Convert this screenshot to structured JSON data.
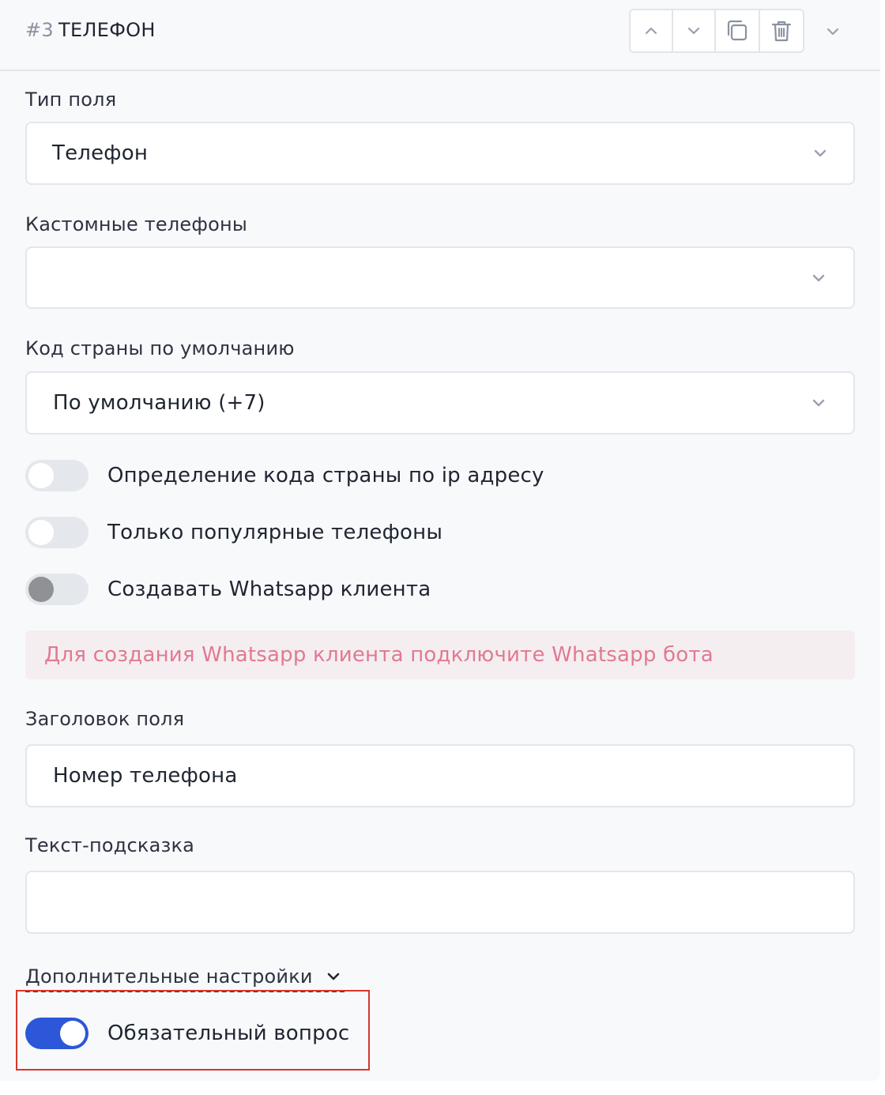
{
  "header": {
    "number": "#3",
    "title": "ТЕЛЕФОН"
  },
  "fields": {
    "field_type": {
      "label": "Тип поля",
      "value": "Телефон"
    },
    "custom_phones": {
      "label": "Кастомные телефоны",
      "value": ""
    },
    "country_code": {
      "label": "Код страны по умолчанию",
      "value": "По умолчанию (+7)"
    }
  },
  "toggles": {
    "ip_detect": {
      "label": "Определение кода страны по ip адресу",
      "on": false
    },
    "popular_only": {
      "label": "Только популярные телефоны",
      "on": false
    },
    "whatsapp": {
      "label": "Создавать Whatsapp клиента",
      "on": false
    }
  },
  "alert": {
    "text": "Для создания Whatsapp клиента подключите Whatsapp бота"
  },
  "field_title": {
    "label": "Заголовок поля",
    "value": "Номер телефона"
  },
  "hint_text": {
    "label": "Текст-подсказка",
    "value": ""
  },
  "advanced": {
    "label": "Дополнительные настройки"
  },
  "required": {
    "label": "Обязательный вопрос",
    "on": true
  },
  "colors": {
    "accent": "#2b57d8",
    "alert_text": "#e07a92",
    "alert_bg": "#f5eef1",
    "highlight_border": "#d9362b"
  }
}
